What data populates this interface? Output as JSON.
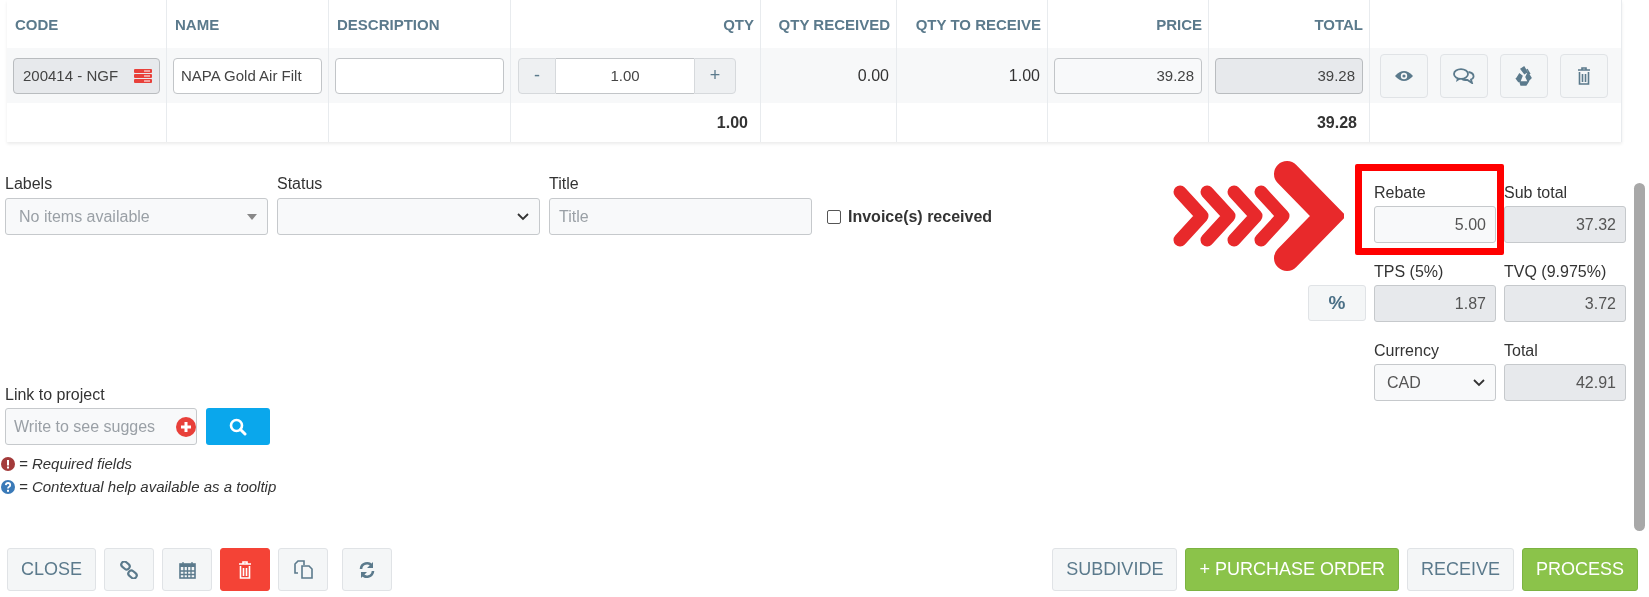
{
  "table": {
    "columns": [
      "CODE",
      "NAME",
      "DESCRIPTION",
      "QTY",
      "QTY RECEIVED",
      "QTY TO RECEIVE",
      "PRICE",
      "TOTAL"
    ],
    "rows": [
      {
        "code": "200414 - NGF",
        "name": "NAPA Gold Air Filt",
        "qty": {
          "minus": "-",
          "value": "1.00",
          "plus": "+"
        },
        "qty_received": "0.00",
        "qty_to_receive": "1.00",
        "price": "39.28",
        "total": "39.28"
      }
    ],
    "totals": {
      "qty": "1.00",
      "total": "39.28"
    }
  },
  "form": {
    "labels": {
      "label": "Labels",
      "placeholder": "No items available"
    },
    "status": {
      "label": "Status"
    },
    "title": {
      "label": "Title",
      "placeholder": "Title"
    },
    "invoice_received": {
      "label": "Invoice(s) received",
      "checked": false
    },
    "link_to_project": {
      "label": "Link to project",
      "placeholder": "Write to see sugges"
    },
    "legend": [
      "= Required fields",
      "= Contextual help available as a tooltip"
    ]
  },
  "summary": {
    "percent_button": "%",
    "rebate": {
      "label": "Rebate",
      "value": "5.00"
    },
    "sub_total": {
      "label": "Sub total",
      "value": "37.32"
    },
    "tps": {
      "label": "TPS (5%)",
      "value": "1.87"
    },
    "tvq": {
      "label": "TVQ (9.975%)",
      "value": "3.72"
    },
    "currency": {
      "label": "Currency",
      "value": "CAD"
    },
    "total": {
      "label": "Total",
      "value": "42.91"
    }
  },
  "left_buttons": [
    {
      "kind": "text",
      "label": "CLOSE"
    },
    {
      "kind": "link"
    },
    {
      "kind": "calendar"
    },
    {
      "kind": "delete"
    },
    {
      "kind": "copy"
    },
    {
      "kind": "refresh"
    }
  ],
  "right_buttons": [
    {
      "kind": "default",
      "label": "SUBDIVIDE"
    },
    {
      "kind": "primary",
      "label": "+ PURCHASE ORDER"
    },
    {
      "kind": "default",
      "label": "RECEIVE"
    },
    {
      "kind": "primary",
      "label": "PROCESS"
    }
  ]
}
